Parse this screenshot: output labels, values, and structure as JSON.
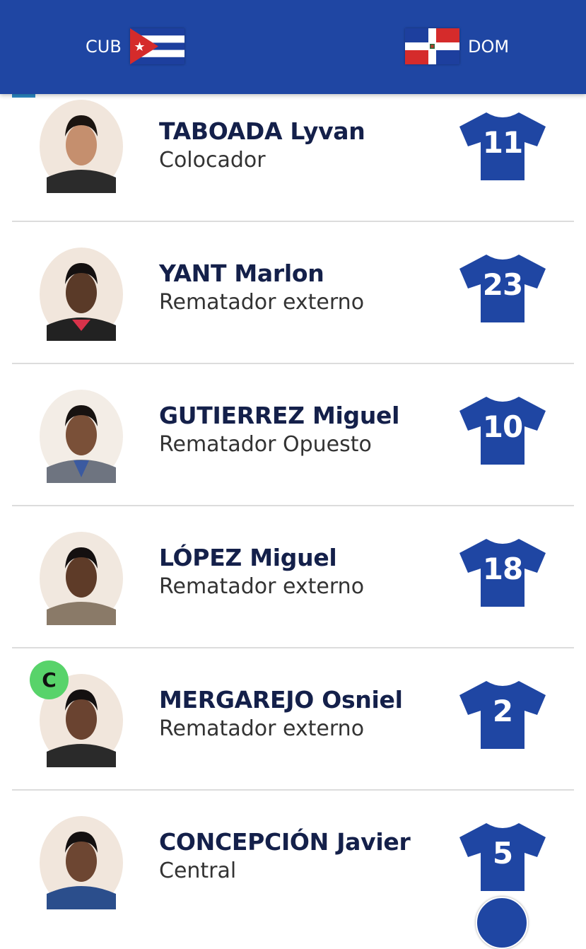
{
  "header": {
    "home_team": {
      "code": "CUB",
      "flag_icon": "cuba-flag-icon"
    },
    "away_team": {
      "code": "DOM",
      "flag_icon": "dominican-republic-flag-icon"
    },
    "background": "#1f46a3"
  },
  "players": [
    {
      "name": "TABOADA Lyvan",
      "position": "Colocador",
      "number": "11",
      "captain": false,
      "skin": "#c58f6e",
      "shirt": "#2b2b2b"
    },
    {
      "name": "YANT Marlon",
      "position": "Rematador externo",
      "number": "23",
      "captain": false,
      "skin": "#5a3a28",
      "shirt": "#222222"
    },
    {
      "name": "GUTIERREZ Miguel",
      "position": "Rematador Opuesto",
      "number": "10",
      "captain": false,
      "skin": "#7a5038",
      "shirt": "#4a5a7a"
    },
    {
      "name": "LÓPEZ Miguel",
      "position": "Rematador externo",
      "number": "18",
      "captain": false,
      "skin": "#5e3b28",
      "shirt": "#8a7a68"
    },
    {
      "name": "MERGAREJO Osniel",
      "position": "Rematador externo",
      "number": "2",
      "captain": true,
      "captain_label": "C",
      "skin": "#6a4330",
      "shirt": "#2a2a2a"
    },
    {
      "name": "CONCEPCIÓN Javier",
      "position": "Central",
      "number": "5",
      "captain": false,
      "skin": "#6d4632",
      "shirt": "#2b4e8c"
    }
  ],
  "colors": {
    "jersey": "#1f46a3",
    "captain_badge": "#58d36a",
    "name_text": "#14204a"
  }
}
